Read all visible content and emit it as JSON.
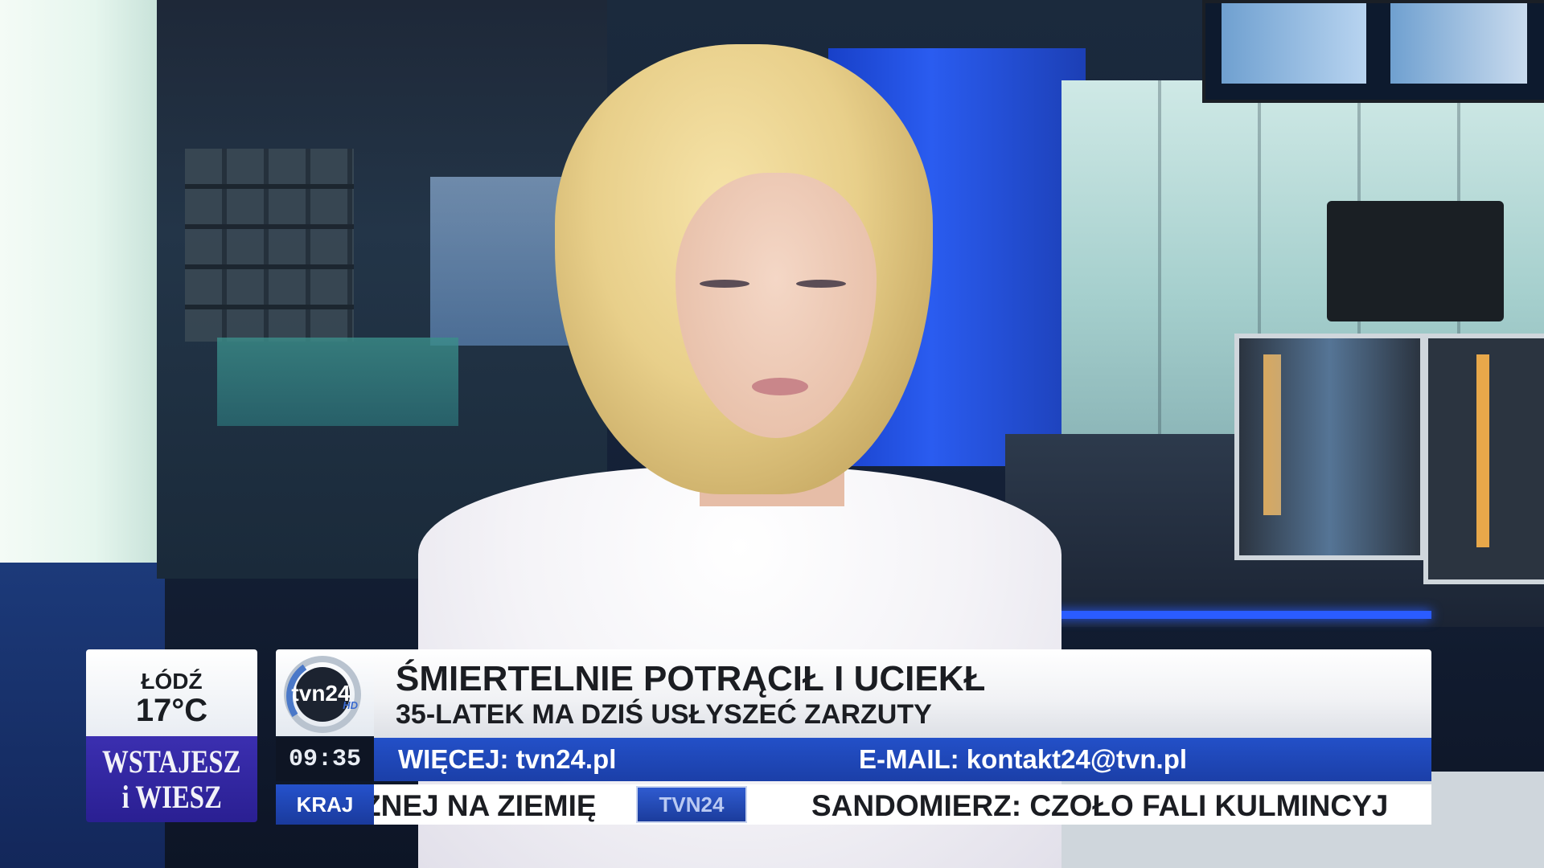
{
  "weather": {
    "city": "ŁÓDŹ",
    "temperature": "17°C"
  },
  "program": {
    "logo_line1": "WSTAJESZ",
    "logo_line2": "i WIESZ"
  },
  "channel": {
    "logo_text": "tvn24",
    "logo_sub": "HD"
  },
  "headline": {
    "title": "ŚMIERTELNIE POTRĄCIŁ I UCIEKŁ",
    "subtitle": "35-LATEK MA DZIŚ USŁYSZEĆ ZARZUTY"
  },
  "clock": {
    "time": "09:35"
  },
  "info_bar": {
    "more": "WIĘCEJ: tvn24.pl",
    "email": "E-MAIL: kontakt24@tvn.pl"
  },
  "ticker": {
    "category": "KRAJ",
    "item_left": "ŻNEJ NA ZIEMIĘ",
    "badge": "TVN24",
    "item_right": "SANDOMIERZ: CZOŁO FALI KULMINCYJ"
  },
  "colors": {
    "accent_blue": "#1b3fa8",
    "program_purple": "#2a1f92",
    "headline_text": "#1b1d22"
  }
}
